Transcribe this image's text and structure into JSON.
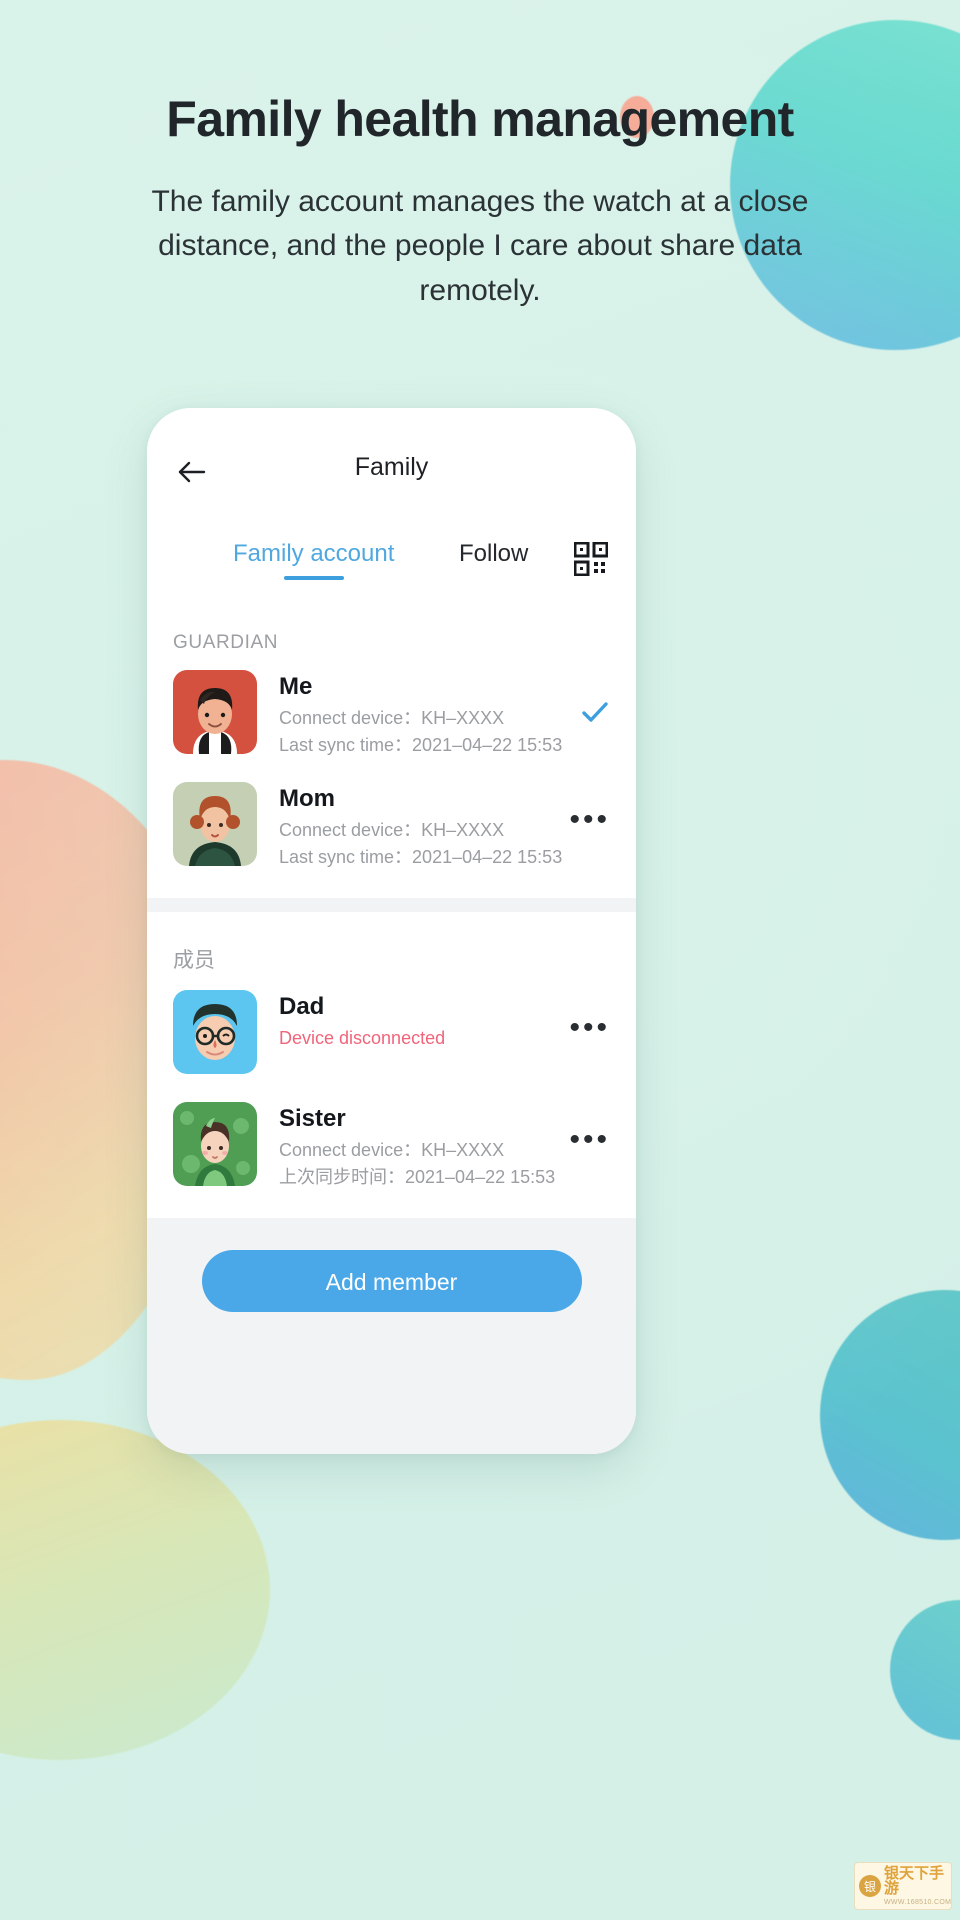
{
  "promo": {
    "title": "Family health management",
    "subtitle": "The family account manages the watch at a close distance, and the people I care about share data remotely."
  },
  "colors": {
    "accent": "#4ba8e8",
    "tab_active": "#50a8e0",
    "alert": "#f2647a",
    "background": "#d8f2e9"
  },
  "phone": {
    "navbar": {
      "back_icon": "arrow-left-icon",
      "title": "Family"
    },
    "tabs": [
      {
        "label": "Family account",
        "active": true
      },
      {
        "label": "Follow",
        "active": false
      }
    ],
    "qr_icon": "qr-code-icon",
    "sections": [
      {
        "title": "GUARDIAN",
        "members": [
          {
            "name": "Me",
            "device_label": "Connect device：",
            "device_value": "KH–XXXX",
            "sync_label": "Last sync time：",
            "sync_value": "2021–04–22  15:53",
            "action": "check",
            "status": null
          },
          {
            "name": "Mom",
            "device_label": "Connect device：",
            "device_value": "KH–XXXX",
            "sync_label": "Last sync time：",
            "sync_value": "2021–04–22  15:53",
            "action": "more",
            "status": null
          }
        ]
      },
      {
        "title": "成员",
        "members": [
          {
            "name": "Dad",
            "device_label": null,
            "device_value": null,
            "sync_label": null,
            "sync_value": null,
            "action": "more",
            "status": "Device disconnected"
          },
          {
            "name": "Sister",
            "device_label": "Connect device：",
            "device_value": "KH–XXXX",
            "sync_label": "上次同步时间：",
            "sync_value": "2021–04–22  15:53",
            "action": "more",
            "status": null
          }
        ]
      }
    ],
    "add_member_label": "Add member"
  },
  "watermark": {
    "name": "银天下手游",
    "url": "WWW.168510.COM"
  }
}
